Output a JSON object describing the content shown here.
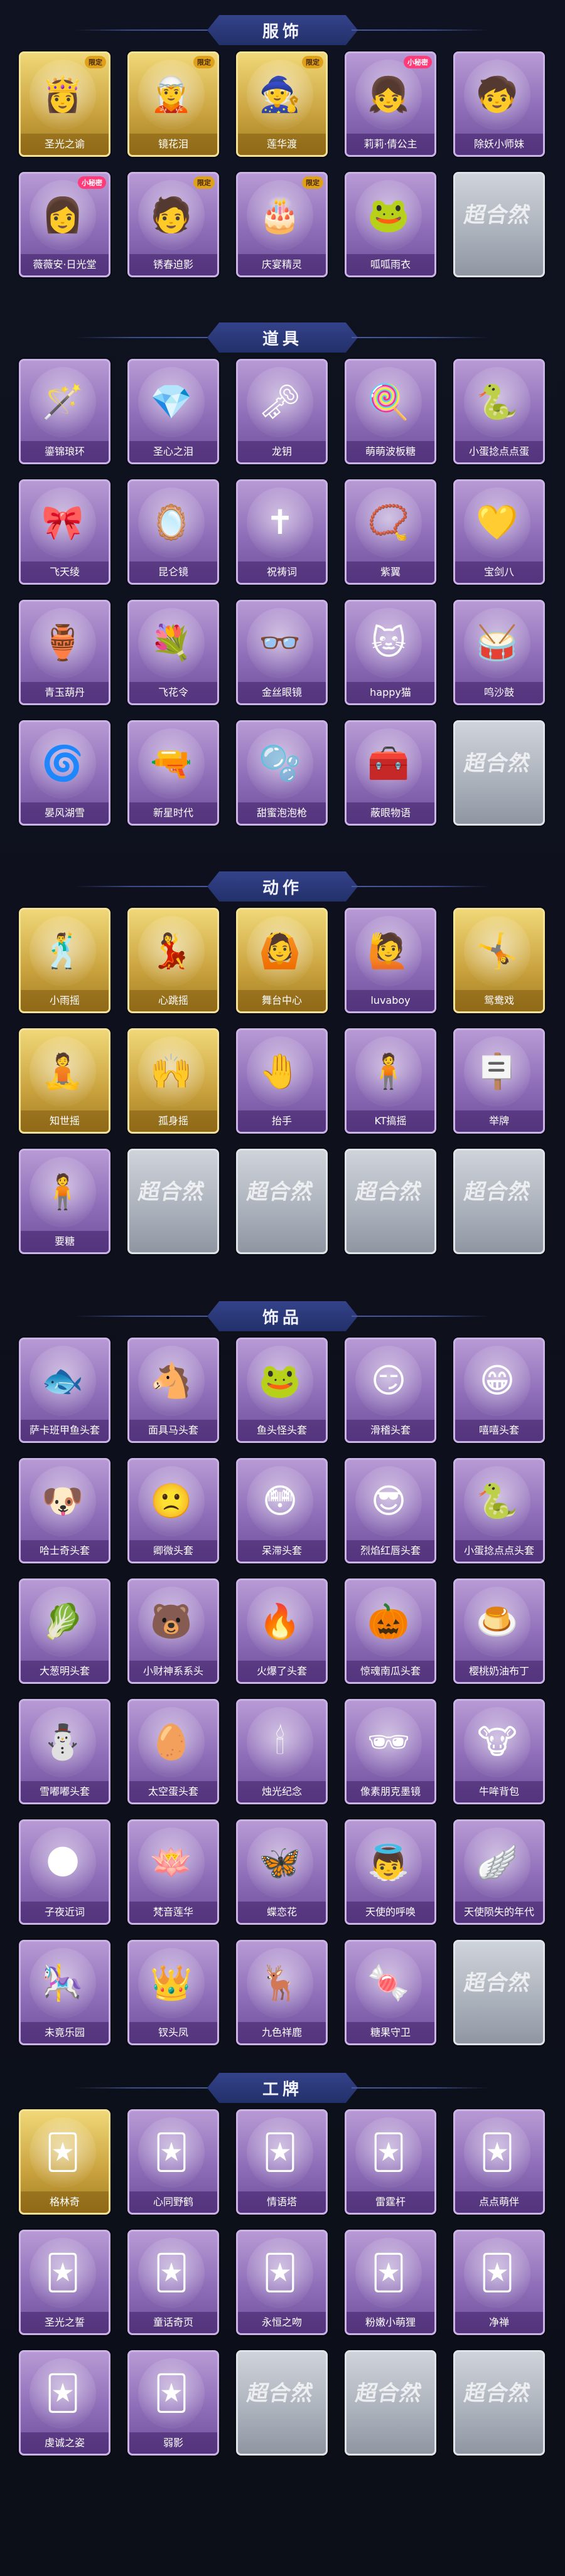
{
  "sections": [
    {
      "title": "服饰",
      "items": [
        {
          "label": "圣光之谕",
          "style": "gold",
          "icon": "👸",
          "badge": "限定"
        },
        {
          "label": "镜花泪",
          "style": "gold",
          "icon": "🧝",
          "badge": "限定"
        },
        {
          "label": "莲华渡",
          "style": "gold",
          "icon": "🧙",
          "badge": "限定"
        },
        {
          "label": "莉莉·倩公主",
          "style": "purple",
          "icon": "👧",
          "badge": "小秘密"
        },
        {
          "label": "除妖小师妹",
          "style": "purple",
          "icon": "🧒",
          "badge": ""
        },
        {
          "label": "薇薇安·日光堂",
          "style": "purple",
          "icon": "👩",
          "badge": "小秘密"
        },
        {
          "label": "锈春迫影",
          "style": "purple",
          "icon": "🧑",
          "badge": "限定"
        },
        {
          "label": "庆宴精灵",
          "style": "purple",
          "icon": "🎂",
          "badge": "限定"
        },
        {
          "label": "呱呱雨衣",
          "style": "purple",
          "icon": "🐸",
          "badge": ""
        },
        {
          "label": "",
          "style": "empty",
          "icon": "",
          "badge": ""
        }
      ]
    },
    {
      "title": "道具",
      "items": [
        {
          "label": "鎏锦琅环",
          "style": "purple",
          "icon": "🪄",
          "badge": ""
        },
        {
          "label": "圣心之泪",
          "style": "purple",
          "icon": "💎",
          "badge": ""
        },
        {
          "label": "龙钥",
          "style": "purple",
          "icon": "🗝",
          "badge": ""
        },
        {
          "label": "萌萌波板糖",
          "style": "purple",
          "icon": "🍭",
          "badge": ""
        },
        {
          "label": "小蛋捻点点蛋",
          "style": "purple",
          "icon": "🐍",
          "badge": ""
        },
        {
          "label": "飞天绫",
          "style": "purple",
          "icon": "🎀",
          "badge": ""
        },
        {
          "label": "昆仑镜",
          "style": "purple",
          "icon": "🪞",
          "badge": ""
        },
        {
          "label": "祝祷词",
          "style": "purple",
          "icon": "✝",
          "badge": ""
        },
        {
          "label": "紫翼",
          "style": "purple",
          "icon": "📿",
          "badge": ""
        },
        {
          "label": "宝剑八",
          "style": "purple",
          "icon": "💛",
          "badge": ""
        },
        {
          "label": "青玉葫丹",
          "style": "purple",
          "icon": "🏺",
          "badge": ""
        },
        {
          "label": "飞花令",
          "style": "purple",
          "icon": "💐",
          "badge": ""
        },
        {
          "label": "金丝眼镜",
          "style": "purple",
          "icon": "👓",
          "badge": ""
        },
        {
          "label": "happy猫",
          "style": "purple",
          "icon": "🐱",
          "badge": ""
        },
        {
          "label": "鸣沙鼓",
          "style": "purple",
          "icon": "🥁",
          "badge": ""
        },
        {
          "label": "晏风湖雪",
          "style": "purple",
          "icon": "🌀",
          "badge": ""
        },
        {
          "label": "新星时代",
          "style": "purple",
          "icon": "🔫",
          "badge": ""
        },
        {
          "label": "甜蜜泡泡枪",
          "style": "purple",
          "icon": "🫧",
          "badge": ""
        },
        {
          "label": "蔽眼物语",
          "style": "purple",
          "icon": "🧰",
          "badge": ""
        },
        {
          "label": "",
          "style": "empty",
          "icon": "",
          "badge": ""
        }
      ]
    },
    {
      "title": "动作",
      "items": [
        {
          "label": "小雨摇",
          "style": "gold",
          "icon": "🕺",
          "badge": ""
        },
        {
          "label": "心跳摇",
          "style": "gold",
          "icon": "💃",
          "badge": ""
        },
        {
          "label": "舞台中心",
          "style": "gold",
          "icon": "🙆",
          "badge": ""
        },
        {
          "label": "luvaboy",
          "style": "purple",
          "icon": "🙋",
          "badge": ""
        },
        {
          "label": "鸳鸯戏",
          "style": "gold",
          "icon": "🤸",
          "badge": ""
        },
        {
          "label": "知世摇",
          "style": "gold",
          "icon": "🧘",
          "badge": ""
        },
        {
          "label": "孤身摇",
          "style": "gold",
          "icon": "🙌",
          "badge": ""
        },
        {
          "label": "抬手",
          "style": "purple",
          "icon": "🤚",
          "badge": ""
        },
        {
          "label": "KT搞摇",
          "style": "purple",
          "icon": "🧍",
          "badge": ""
        },
        {
          "label": "举牌",
          "style": "purple",
          "icon": "🪧",
          "badge": ""
        },
        {
          "label": "要糖",
          "style": "purple",
          "icon": "🧍",
          "badge": ""
        },
        {
          "label": "",
          "style": "empty",
          "icon": "",
          "badge": ""
        },
        {
          "label": "",
          "style": "empty",
          "icon": "",
          "badge": ""
        },
        {
          "label": "",
          "style": "empty",
          "icon": "",
          "badge": ""
        },
        {
          "label": "",
          "style": "empty",
          "icon": "",
          "badge": ""
        }
      ]
    },
    {
      "title": "饰品",
      "items": [
        {
          "label": "萨卡班甲鱼头套",
          "style": "purple",
          "icon": "🐟",
          "badge": ""
        },
        {
          "label": "面具马头套",
          "style": "purple",
          "icon": "🐴",
          "badge": ""
        },
        {
          "label": "鱼头怪头套",
          "style": "purple",
          "icon": "🐸",
          "badge": ""
        },
        {
          "label": "滑稽头套",
          "style": "purple",
          "icon": "😏",
          "badge": ""
        },
        {
          "label": "嘻嘻头套",
          "style": "purple",
          "icon": "😁",
          "badge": ""
        },
        {
          "label": "哈士奇头套",
          "style": "purple",
          "icon": "🐶",
          "badge": ""
        },
        {
          "label": "卿微头套",
          "style": "purple",
          "icon": "🙁",
          "badge": ""
        },
        {
          "label": "呆滞头套",
          "style": "purple",
          "icon": "😳",
          "badge": ""
        },
        {
          "label": "烈焰红唇头套",
          "style": "purple",
          "icon": "😎",
          "badge": ""
        },
        {
          "label": "小蛋捻点点头套",
          "style": "purple",
          "icon": "🐍",
          "badge": ""
        },
        {
          "label": "大葱明头套",
          "style": "purple",
          "icon": "🥬",
          "badge": ""
        },
        {
          "label": "小财神系系头",
          "style": "purple",
          "icon": "🐻",
          "badge": ""
        },
        {
          "label": "火爆了头套",
          "style": "purple",
          "icon": "🔥",
          "badge": ""
        },
        {
          "label": "惊魂南瓜头套",
          "style": "purple",
          "icon": "🎃",
          "badge": ""
        },
        {
          "label": "樱桃奶油布丁",
          "style": "purple",
          "icon": "🍮",
          "badge": ""
        },
        {
          "label": "雪嘟嘟头套",
          "style": "purple",
          "icon": "⛄",
          "badge": ""
        },
        {
          "label": "太空蛋头套",
          "style": "purple",
          "icon": "🥚",
          "badge": ""
        },
        {
          "label": "烛光纪念",
          "style": "purple",
          "icon": "🕯",
          "badge": ""
        },
        {
          "label": "像素朋克墨镜",
          "style": "purple",
          "icon": "🕶",
          "badge": ""
        },
        {
          "label": "牛哞背包",
          "style": "purple",
          "icon": "🐮",
          "badge": ""
        },
        {
          "label": "子夜近词",
          "style": "purple",
          "icon": "🌑",
          "badge": ""
        },
        {
          "label": "梵音莲华",
          "style": "purple",
          "icon": "🪷",
          "badge": ""
        },
        {
          "label": "蝶恋花",
          "style": "purple",
          "icon": "🦋",
          "badge": ""
        },
        {
          "label": "天使的呼唤",
          "style": "purple",
          "icon": "👼",
          "badge": ""
        },
        {
          "label": "天使陨失的年代",
          "style": "purple",
          "icon": "🪽",
          "badge": ""
        },
        {
          "label": "未竟乐园",
          "style": "purple",
          "icon": "🎠",
          "badge": ""
        },
        {
          "label": "钗头凤",
          "style": "purple",
          "icon": "👑",
          "badge": ""
        },
        {
          "label": "九色祥鹿",
          "style": "purple",
          "icon": "🦌",
          "badge": ""
        },
        {
          "label": "糖果守卫",
          "style": "purple",
          "icon": "🍬",
          "badge": ""
        },
        {
          "label": "",
          "style": "empty",
          "icon": "",
          "badge": ""
        }
      ]
    },
    {
      "title": "工牌",
      "items": [
        {
          "label": "格林奇",
          "style": "gold",
          "icon": "🃏",
          "badge": ""
        },
        {
          "label": "心同野鹤",
          "style": "purple",
          "icon": "🃏",
          "badge": ""
        },
        {
          "label": "情语塔",
          "style": "purple",
          "icon": "🃏",
          "badge": ""
        },
        {
          "label": "雷霆杆",
          "style": "purple",
          "icon": "🃏",
          "badge": ""
        },
        {
          "label": "点点萌伴",
          "style": "purple",
          "icon": "🃏",
          "badge": ""
        },
        {
          "label": "圣光之誓",
          "style": "purple",
          "icon": "🃏",
          "badge": ""
        },
        {
          "label": "童话奇页",
          "style": "purple",
          "icon": "🃏",
          "badge": ""
        },
        {
          "label": "永恒之吻",
          "style": "purple",
          "icon": "🃏",
          "badge": ""
        },
        {
          "label": "粉嫩小萌狸",
          "style": "purple",
          "icon": "🃏",
          "badge": ""
        },
        {
          "label": "净禅",
          "style": "purple",
          "icon": "🃏",
          "badge": ""
        },
        {
          "label": "虔诚之姿",
          "style": "purple",
          "icon": "🃏",
          "badge": ""
        },
        {
          "label": "弱影",
          "style": "purple",
          "icon": "🃏",
          "badge": ""
        },
        {
          "label": "",
          "style": "empty",
          "icon": "",
          "badge": ""
        },
        {
          "label": "",
          "style": "empty",
          "icon": "",
          "badge": ""
        },
        {
          "label": "",
          "style": "empty",
          "icon": "",
          "badge": ""
        }
      ]
    }
  ],
  "empty_logo": "超合然"
}
